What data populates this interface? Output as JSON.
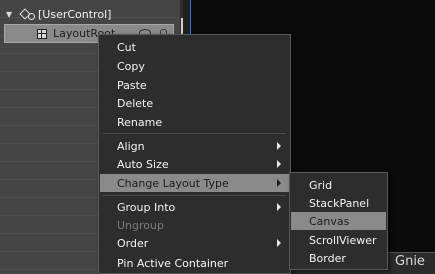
{
  "tree": {
    "usercontrol_label": "[UserControl]",
    "layoutroot_label": "LayoutRoot"
  },
  "context_menu": {
    "items": [
      {
        "label": "Cut"
      },
      {
        "label": "Copy"
      },
      {
        "label": "Paste"
      },
      {
        "label": "Delete"
      },
      {
        "label": "Rename"
      },
      {
        "label": "Align"
      },
      {
        "label": "Auto Size"
      },
      {
        "label": "Change Layout Type"
      },
      {
        "label": "Group Into"
      },
      {
        "label": "Ungroup"
      },
      {
        "label": "Order"
      },
      {
        "label": "Pin Active Container"
      }
    ]
  },
  "submenu": {
    "items": [
      {
        "label": "Grid"
      },
      {
        "label": "StackPanel"
      },
      {
        "label": "Canvas"
      },
      {
        "label": "ScrollViewer"
      },
      {
        "label": "Border"
      }
    ]
  },
  "status": {
    "partial_text": "Gnie"
  }
}
